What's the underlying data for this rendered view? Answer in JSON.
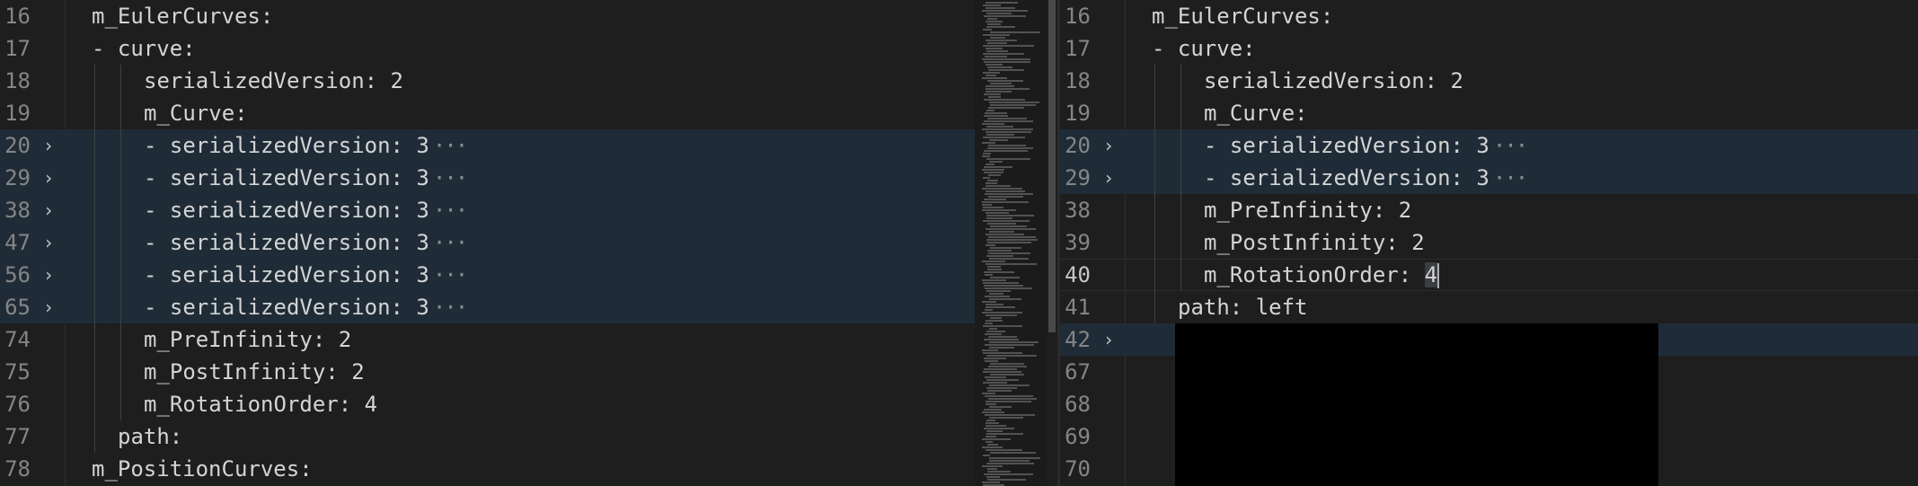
{
  "left": {
    "lines": [
      {
        "num": "16",
        "indent": 0,
        "text": "m_EulerCurves:",
        "fold": false,
        "highlight": false
      },
      {
        "num": "17",
        "indent": 0,
        "text": "- curve:",
        "fold": false,
        "highlight": false
      },
      {
        "num": "18",
        "indent": 2,
        "text": "serializedVersion: 2",
        "fold": false,
        "highlight": false
      },
      {
        "num": "19",
        "indent": 2,
        "text": "m_Curve:",
        "fold": false,
        "highlight": false
      },
      {
        "num": "20",
        "indent": 2,
        "text": "- serializedVersion: 3",
        "fold": true,
        "highlight": true
      },
      {
        "num": "29",
        "indent": 2,
        "text": "- serializedVersion: 3",
        "fold": true,
        "highlight": true
      },
      {
        "num": "38",
        "indent": 2,
        "text": "- serializedVersion: 3",
        "fold": true,
        "highlight": true
      },
      {
        "num": "47",
        "indent": 2,
        "text": "- serializedVersion: 3",
        "fold": true,
        "highlight": true
      },
      {
        "num": "56",
        "indent": 2,
        "text": "- serializedVersion: 3",
        "fold": true,
        "highlight": true
      },
      {
        "num": "65",
        "indent": 2,
        "text": "- serializedVersion: 3",
        "fold": true,
        "highlight": true
      },
      {
        "num": "74",
        "indent": 2,
        "text": "m_PreInfinity: 2",
        "fold": false,
        "highlight": false
      },
      {
        "num": "75",
        "indent": 2,
        "text": "m_PostInfinity: 2",
        "fold": false,
        "highlight": false
      },
      {
        "num": "76",
        "indent": 2,
        "text": "m_RotationOrder: 4",
        "fold": false,
        "highlight": false
      },
      {
        "num": "77",
        "indent": 1,
        "text": "path:",
        "fold": false,
        "highlight": false
      },
      {
        "num": "78",
        "indent": 0,
        "text": "m_PositionCurves:",
        "fold": false,
        "highlight": false
      }
    ]
  },
  "right": {
    "lines": [
      {
        "num": "16",
        "indent": 0,
        "text": "m_EulerCurves:",
        "fold": false,
        "highlight": false
      },
      {
        "num": "17",
        "indent": 0,
        "text": "- curve:",
        "fold": false,
        "highlight": false
      },
      {
        "num": "18",
        "indent": 2,
        "text": "serializedVersion: 2",
        "fold": false,
        "highlight": false
      },
      {
        "num": "19",
        "indent": 2,
        "text": "m_Curve:",
        "fold": false,
        "highlight": false
      },
      {
        "num": "20",
        "indent": 2,
        "text": "- serializedVersion: 3",
        "fold": true,
        "highlight": true
      },
      {
        "num": "29",
        "indent": 2,
        "text": "- serializedVersion: 3",
        "fold": true,
        "highlight": true
      },
      {
        "num": "38",
        "indent": 2,
        "text": "m_PreInfinity: 2",
        "fold": false,
        "highlight": false
      },
      {
        "num": "39",
        "indent": 2,
        "text": "m_PostInfinity: 2",
        "fold": false,
        "highlight": false
      },
      {
        "num": "40",
        "indent": 2,
        "text": "m_RotationOrder: ",
        "selected": "4",
        "fold": false,
        "highlight": false,
        "current": true
      },
      {
        "num": "41",
        "indent": 1,
        "text": "path: left",
        "fold": false,
        "highlight": false
      },
      {
        "num": "42",
        "indent": 0,
        "text": "",
        "fold": true,
        "highlight": true
      },
      {
        "num": "67",
        "indent": 0,
        "text": "",
        "fold": false,
        "highlight": false
      },
      {
        "num": "68",
        "indent": 0,
        "text": "",
        "fold": false,
        "highlight": false
      },
      {
        "num": "69",
        "indent": 0,
        "text": "",
        "fold": false,
        "highlight": false
      },
      {
        "num": "70",
        "indent": 0,
        "text": "",
        "fold": false,
        "highlight": false
      }
    ]
  },
  "glyphs": {
    "fold": "›",
    "ellipsis": "···"
  }
}
